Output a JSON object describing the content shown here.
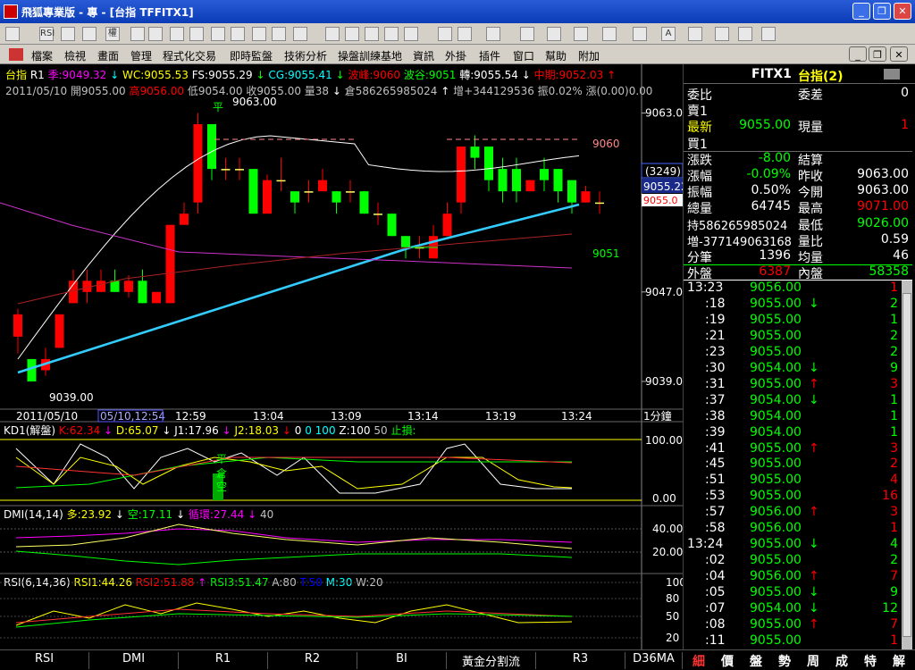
{
  "window": {
    "title": "飛狐專業版 - 專 - [台指 TFFITX1]",
    "min": "_",
    "restore": "❐",
    "close": "✕",
    "inner_min": "_",
    "inner_restore": "❐",
    "inner_close": "✕"
  },
  "toolbar": {
    "icons": [
      "open-icon",
      "rsi-icon",
      "move-icon",
      "link-icon",
      "weight-icon",
      "color1-icon",
      "color2-icon",
      "copy-icon",
      "book-icon",
      "search-icon",
      "target-icon",
      "warn-icon",
      "dollar-icon",
      "tab1-icon",
      "tab2-icon",
      "tab3-icon",
      "tab4-icon",
      "tab5-icon",
      "cursor-icon",
      "line-icon",
      "level-icon",
      "vbar-icon",
      "fan-icon",
      "grid-icon",
      "gann-icon",
      "rect-icon",
      "circle-icon",
      "text-icon",
      "copy2-icon",
      "eraser-icon",
      "palette-icon",
      "save-icon"
    ],
    "labels": [
      "",
      "RSI",
      "",
      "",
      "權",
      "",
      "",
      "",
      "",
      "",
      "",
      "",
      "",
      "",
      "",
      "",
      "",
      "",
      "",
      "",
      "",
      "",
      "",
      "",
      "",
      "",
      "",
      "A",
      "",
      "",
      "",
      ""
    ]
  },
  "menu": [
    "檔案",
    "檢視",
    "畫面",
    "管理",
    "程式化交易",
    "即時監盤",
    "技術分析",
    "操盤訓練基地",
    "資訊",
    "外掛",
    "插件",
    "窗口",
    "幫助",
    "附加"
  ],
  "header": {
    "line1": [
      {
        "t": "台指",
        "c": "#ffff00"
      },
      {
        "t": "R1",
        "c": "#ffffff"
      },
      {
        "t": "季:9049.32",
        "c": "#ff00ff"
      },
      {
        "t": "↓",
        "c": "#00ffff"
      },
      {
        "t": "WC:9055.53",
        "c": "#ffff00"
      },
      {
        "t": "FS:9055.29",
        "c": "#ffffff"
      },
      {
        "t": "↓",
        "c": "#00ff00"
      },
      {
        "t": "CG:9055.41",
        "c": "#00ffff"
      },
      {
        "t": "↓",
        "c": "#00ff00"
      },
      {
        "t": "波峰:9060",
        "c": "#ff0000"
      },
      {
        "t": "波谷:9051",
        "c": "#00ff00"
      },
      {
        "t": "轉:9055.54",
        "c": "#ffffff"
      },
      {
        "t": "↓",
        "c": "#ffffff"
      },
      {
        "t": "中期:9052.03",
        "c": "#ff0000"
      },
      {
        "t": "↑",
        "c": "#ff0000"
      }
    ],
    "line2": [
      {
        "t": "2011/05/10",
        "c": "#c0c0c0"
      },
      {
        "t": "開9055.00",
        "c": "#c0c0c0"
      },
      {
        "t": "高9056.00",
        "c": "#ff0000"
      },
      {
        "t": "低9054.00",
        "c": "#c0c0c0"
      },
      {
        "t": "收9055.00",
        "c": "#c0c0c0"
      },
      {
        "t": "量38",
        "c": "#c0c0c0"
      },
      {
        "t": "↓",
        "c": "#ffffff"
      },
      {
        "t": "倉586265985024",
        "c": "#c0c0c0"
      },
      {
        "t": "↑",
        "c": "#ffffff"
      },
      {
        "t": "增+344129536",
        "c": "#c0c0c0"
      },
      {
        "t": "振0.02%",
        "c": "#c0c0c0"
      },
      {
        "t": "漲(0.00)0.00",
        "c": "#c0c0c0"
      }
    ]
  },
  "price_axis": {
    "labels": [
      "9063.00",
      "9047.0",
      "9039.00"
    ],
    "badge1": "(3249)",
    "badge2": "9055.22",
    "badge3": "9055.0"
  },
  "annotations": {
    "high": "9063.00",
    "low": "9039.00",
    "peak": "9060",
    "trough": "9051",
    "flat1": "平",
    "flat2": "平",
    "short": "空",
    "long": "倉"
  },
  "time_axis": [
    "2011/05/10",
    "05/10,12:54",
    "12:59",
    "13:04",
    "13:09",
    "13:14",
    "13:19",
    "13:24"
  ],
  "period": "1分鐘",
  "kd": {
    "label": [
      {
        "t": "KD1(解盤)",
        "c": "#ffffff"
      },
      {
        "t": "K:62.34",
        "c": "#ff0000"
      },
      {
        "t": "↓",
        "c": "#ff00ff"
      },
      {
        "t": "D:65.07",
        "c": "#ffff00"
      },
      {
        "t": "↓",
        "c": "#ffffff"
      },
      {
        "t": "J1:17.96",
        "c": "#ffffff"
      },
      {
        "t": "↓",
        "c": "#ff00ff"
      },
      {
        "t": "J2:18.03",
        "c": "#ffff00"
      },
      {
        "t": "↓",
        "c": "#ff0000"
      },
      {
        "t": "0",
        "c": "#ffffff"
      },
      {
        "t": "0",
        "c": "#00ffff"
      },
      {
        "t": "100",
        "c": "#00ffff"
      },
      {
        "t": "Z:100",
        "c": "#ffffff"
      },
      {
        "t": "50",
        "c": "#c0c0c0"
      },
      {
        "t": "止損:",
        "c": "#00ff00"
      }
    ],
    "axis": [
      "100.00",
      "0.00"
    ]
  },
  "dmi": {
    "label": [
      {
        "t": "DMI(14,14)",
        "c": "#ffffff"
      },
      {
        "t": "多:23.92",
        "c": "#ffff00"
      },
      {
        "t": "↓",
        "c": "#ffffff"
      },
      {
        "t": "空:17.11",
        "c": "#00ff00"
      },
      {
        "t": "↓",
        "c": "#ffffff"
      },
      {
        "t": "循環:27.44",
        "c": "#ff00ff"
      },
      {
        "t": "↓",
        "c": "#ff00ff"
      },
      {
        "t": "40",
        "c": "#c0c0c0"
      }
    ],
    "axis": [
      "40.00",
      "20.00"
    ]
  },
  "rsi": {
    "label": [
      {
        "t": "RSI(6,14,36)",
        "c": "#ffffff"
      },
      {
        "t": "RSI1:44.26",
        "c": "#ffff00"
      },
      {
        "t": "RSI2:51.88",
        "c": "#ff0000"
      },
      {
        "t": "↑",
        "c": "#ff00ff"
      },
      {
        "t": "RSI3:51.47",
        "c": "#00ff00"
      },
      {
        "t": "A:80",
        "c": "#c0c0c0"
      },
      {
        "t": "T:50",
        "c": "#0000ff"
      },
      {
        "t": "M:30",
        "c": "#00ffff"
      },
      {
        "t": "W:20",
        "c": "#c0c0c0"
      }
    ],
    "axis": [
      "100",
      "80",
      "50",
      "20"
    ]
  },
  "bottom_tabs": [
    "RSI",
    "DMI",
    "R1",
    "R2",
    "BI",
    "黃金分割流",
    "R3",
    "D36MA"
  ],
  "right_tabs": [
    "細",
    "價",
    "盤",
    "勢",
    "周",
    "成",
    "特",
    "解"
  ],
  "quote": {
    "symbol": "FITX1",
    "name": "台指(2)",
    "rows": [
      {
        "l": "委比",
        "lc": "#ffffff",
        "v1": "",
        "v1c": "#ffffff",
        "l2": "委差",
        "l2c": "#ffffff",
        "v2": "0",
        "v2c": "#ffffff"
      },
      {
        "l": "賣1",
        "lc": "#ffffff",
        "v1": "",
        "v1c": "#ffffff",
        "l2": "",
        "l2c": "#ffffff",
        "v2": "",
        "v2c": "#ffffff"
      },
      {
        "l": "最新",
        "lc": "#ffff00",
        "v1": "9055.00",
        "v1c": "#00ff00",
        "l2": "現量",
        "l2c": "#ffffff",
        "v2": "1",
        "v2c": "#ff0000"
      },
      {
        "l": "買1",
        "lc": "#ffffff",
        "v1": "",
        "v1c": "#ffffff",
        "l2": "",
        "l2c": "#ffffff",
        "v2": "",
        "v2c": "#ffffff"
      },
      {
        "l": "漲跌",
        "lc": "#ffffff",
        "v1": "-8.00",
        "v1c": "#00ff00",
        "l2": "結算",
        "l2c": "#ffffff",
        "v2": "",
        "v2c": "#ffffff"
      },
      {
        "l": "漲幅",
        "lc": "#ffffff",
        "v1": "-0.09%",
        "v1c": "#00ff00",
        "l2": "昨收",
        "l2c": "#ffffff",
        "v2": "9063.00",
        "v2c": "#ffffff"
      },
      {
        "l": "振幅",
        "lc": "#ffffff",
        "v1": "0.50%",
        "v1c": "#ffffff",
        "l2": "今開",
        "l2c": "#ffffff",
        "v2": "9063.00",
        "v2c": "#ffffff"
      },
      {
        "l": "總量",
        "lc": "#ffffff",
        "v1": "64745",
        "v1c": "#ffffff",
        "l2": "最高",
        "l2c": "#ffffff",
        "v2": "9071.00",
        "v2c": "#ff0000"
      },
      {
        "l": "持586265985024",
        "lc": "#ffffff",
        "v1": "",
        "v1c": "#ffffff",
        "l2": "最低",
        "l2c": "#ffffff",
        "v2": "9026.00",
        "v2c": "#00ff00"
      },
      {
        "l": "増-377149063168",
        "lc": "#ffffff",
        "v1": "",
        "v1c": "#ffffff",
        "l2": "量比",
        "l2c": "#ffffff",
        "v2": "0.59",
        "v2c": "#ffffff"
      },
      {
        "l": "分筆",
        "lc": "#ffffff",
        "v1": "1396",
        "v1c": "#ffffff",
        "l2": "均量",
        "l2c": "#ffffff",
        "v2": "46",
        "v2c": "#ffffff"
      },
      {
        "l": "外盤",
        "lc": "#ffffff",
        "v1": "6387",
        "v1c": "#ff0000",
        "l2": "內盤",
        "l2c": "#ffffff",
        "v2": "58358",
        "v2c": "#00ff00"
      }
    ],
    "ticks": [
      {
        "t": "13:23",
        "p": "9056.00",
        "a": "",
        "v": "1",
        "vc": "#ff0000"
      },
      {
        "t": ":18",
        "p": "9055.00",
        "a": "↓",
        "ac": "#00ff00",
        "v": "2",
        "vc": "#00ff00"
      },
      {
        "t": ":19",
        "p": "9055.00",
        "a": "",
        "v": "1",
        "vc": "#00ff00"
      },
      {
        "t": ":21",
        "p": "9055.00",
        "a": "",
        "v": "2",
        "vc": "#00ff00"
      },
      {
        "t": ":23",
        "p": "9055.00",
        "a": "",
        "v": "2",
        "vc": "#00ff00"
      },
      {
        "t": ":30",
        "p": "9054.00",
        "a": "↓",
        "ac": "#00ff00",
        "v": "9",
        "vc": "#00ff00"
      },
      {
        "t": ":31",
        "p": "9055.00",
        "a": "↑",
        "ac": "#ff0000",
        "v": "3",
        "vc": "#ff0000"
      },
      {
        "t": ":37",
        "p": "9054.00",
        "a": "↓",
        "ac": "#00ff00",
        "v": "1",
        "vc": "#00ff00"
      },
      {
        "t": ":38",
        "p": "9054.00",
        "a": "",
        "v": "1",
        "vc": "#00ff00"
      },
      {
        "t": ":39",
        "p": "9054.00",
        "a": "",
        "v": "1",
        "vc": "#00ff00"
      },
      {
        "t": ":41",
        "p": "9055.00",
        "a": "↑",
        "ac": "#ff0000",
        "v": "3",
        "vc": "#ff0000"
      },
      {
        "t": ":45",
        "p": "9055.00",
        "a": "",
        "v": "2",
        "vc": "#ff0000"
      },
      {
        "t": ":51",
        "p": "9055.00",
        "a": "",
        "v": "4",
        "vc": "#ff0000"
      },
      {
        "t": ":53",
        "p": "9055.00",
        "a": "",
        "v": "16",
        "vc": "#ff0000"
      },
      {
        "t": ":57",
        "p": "9056.00",
        "a": "↑",
        "ac": "#ff0000",
        "v": "3",
        "vc": "#ff0000"
      },
      {
        "t": ":58",
        "p": "9056.00",
        "a": "",
        "v": "1",
        "vc": "#ff0000"
      },
      {
        "t": "13:24",
        "p": "9055.00",
        "a": "↓",
        "ac": "#00ff00",
        "v": "4",
        "vc": "#00ff00"
      },
      {
        "t": ":02",
        "p": "9055.00",
        "a": "",
        "v": "2",
        "vc": "#00ff00"
      },
      {
        "t": ":04",
        "p": "9056.00",
        "a": "↑",
        "ac": "#ff0000",
        "v": "7",
        "vc": "#ff0000"
      },
      {
        "t": ":05",
        "p": "9055.00",
        "a": "↓",
        "ac": "#00ff00",
        "v": "9",
        "vc": "#00ff00"
      },
      {
        "t": ":07",
        "p": "9054.00",
        "a": "↓",
        "ac": "#00ff00",
        "v": "12",
        "vc": "#00ff00"
      },
      {
        "t": ":08",
        "p": "9055.00",
        "a": "↑",
        "ac": "#ff0000",
        "v": "7",
        "vc": "#ff0000"
      },
      {
        "t": ":11",
        "p": "9055.00",
        "a": "",
        "v": "1",
        "vc": "#ff0000"
      }
    ]
  },
  "chart_data": {
    "type": "candlestick",
    "y_axis_ticks": [
      9063,
      9047,
      9039
    ],
    "candles": [
      {
        "o": 9043,
        "c": 9045,
        "h": 9045.5,
        "l": 9041.5
      },
      {
        "o": 9041,
        "c": 9039,
        "h": 9041,
        "l": 9039
      },
      {
        "o": 9040,
        "c": 9041,
        "h": 9042,
        "l": 9039.5
      },
      {
        "o": 9042,
        "c": 9045,
        "h": 9045,
        "l": 9042
      },
      {
        "o": 9046,
        "c": 9048,
        "h": 9049,
        "l": 9046
      },
      {
        "o": 9047,
        "c": 9048,
        "h": 9049,
        "l": 9046
      },
      {
        "o": 9047,
        "c": 9048,
        "h": 9049,
        "l": 9047
      },
      {
        "o": 9048,
        "c": 9047,
        "h": 9049,
        "l": 9047
      },
      {
        "o": 9047,
        "c": 9048,
        "h": 9048.5,
        "l": 9046.5
      },
      {
        "o": 9048,
        "c": 9046,
        "h": 9049,
        "l": 9046
      },
      {
        "o": 9046,
        "c": 9047,
        "h": 9047,
        "l": 9046
      },
      {
        "o": 9046,
        "c": 9053,
        "h": 9053,
        "l": 9046
      },
      {
        "o": 9053,
        "c": 9054,
        "h": 9055,
        "l": 9053
      },
      {
        "o": 9055,
        "c": 9062,
        "h": 9063,
        "l": 9054
      },
      {
        "o": 9062,
        "c": 9058,
        "h": 9062,
        "l": 9057
      },
      {
        "o": 9058,
        "c": 9058,
        "h": 9059,
        "l": 9057
      },
      {
        "o": 9058,
        "c": 9058,
        "h": 9059,
        "l": 9057
      },
      {
        "o": 9058,
        "c": 9054,
        "h": 9058,
        "l": 9054
      },
      {
        "o": 9054,
        "c": 9057,
        "h": 9057.5,
        "l": 9054
      },
      {
        "o": 9057,
        "c": 9057,
        "h": 9059,
        "l": 9056
      },
      {
        "o": 9056,
        "c": 9055,
        "h": 9056,
        "l": 9054
      },
      {
        "o": 9056,
        "c": 9056,
        "h": 9057,
        "l": 9055
      },
      {
        "o": 9056,
        "c": 9057,
        "h": 9058,
        "l": 9056
      },
      {
        "o": 9056,
        "c": 9055,
        "h": 9056,
        "l": 9054
      },
      {
        "o": 9056,
        "c": 9056,
        "h": 9057,
        "l": 9055
      },
      {
        "o": 9056,
        "c": 9054,
        "h": 9056,
        "l": 9054
      },
      {
        "o": 9054,
        "c": 9054,
        "h": 9055,
        "l": 9053
      },
      {
        "o": 9054,
        "c": 9052,
        "h": 9054,
        "l": 9052
      },
      {
        "o": 9052,
        "c": 9051,
        "h": 9052,
        "l": 9050
      },
      {
        "o": 9051,
        "c": 9051,
        "h": 9052,
        "l": 9050
      },
      {
        "o": 9050,
        "c": 9052,
        "h": 9053,
        "l": 9050
      },
      {
        "o": 9052,
        "c": 9054,
        "h": 9055,
        "l": 9052
      },
      {
        "o": 9055,
        "c": 9060,
        "h": 9060,
        "l": 9054
      },
      {
        "o": 9060,
        "c": 9059,
        "h": 9061,
        "l": 9058
      },
      {
        "o": 9060,
        "c": 9057,
        "h": 9060,
        "l": 9056
      },
      {
        "o": 9058,
        "c": 9056,
        "h": 9059,
        "l": 9055
      },
      {
        "o": 9058,
        "c": 9056,
        "h": 9059,
        "l": 9055
      },
      {
        "o": 9056,
        "c": 9057,
        "h": 9057,
        "l": 9056
      },
      {
        "o": 9058,
        "c": 9057,
        "h": 9059,
        "l": 9056
      },
      {
        "o": 9058,
        "c": 9056,
        "h": 9058,
        "l": 9055
      },
      {
        "o": 9057,
        "c": 9055,
        "h": 9057,
        "l": 9054
      },
      {
        "o": 9055,
        "c": 9056,
        "h": 9056.5,
        "l": 9055
      },
      {
        "o": 9055,
        "c": 9055,
        "h": 9056,
        "l": 9054
      }
    ]
  }
}
